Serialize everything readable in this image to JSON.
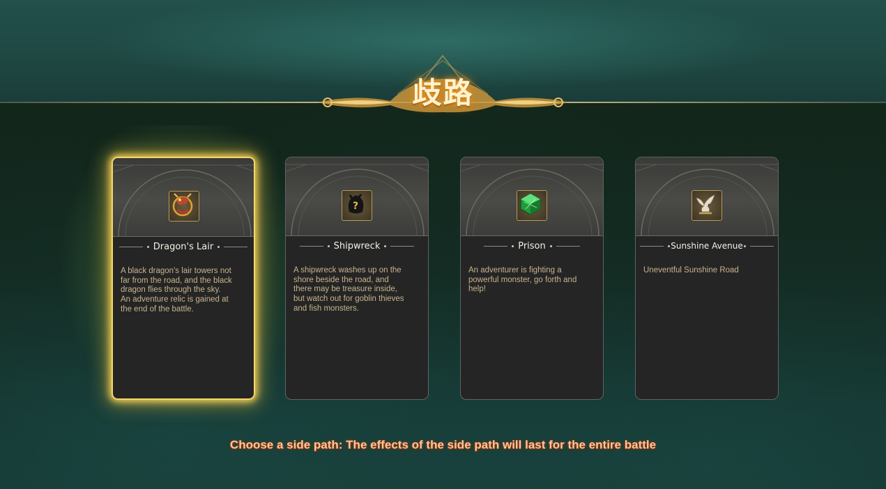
{
  "screen": {
    "title": "歧路",
    "hint": "Choose a side path: The effects of the side path will last for the entire battle",
    "accent_color": "#f4d66a",
    "hint_color": "#ffc59a"
  },
  "cards": [
    {
      "name": "Dragon's Lair",
      "icon": "dragon-icon",
      "selected": true,
      "description": "A black dragon's lair towers not far from the road, and the black dragon flies through the sky. An adventure relic is gained at the end of the battle."
    },
    {
      "name": "Shipwreck",
      "icon": "mystery-bag-icon",
      "selected": false,
      "description": "A shipwreck washes up on the shore beside the road, and there may be treasure inside, but watch out for goblin thieves and fish monsters."
    },
    {
      "name": "Prison",
      "icon": "green-gem-icon",
      "selected": false,
      "description": "An adventurer is fighting a powerful monster, go forth and help!"
    },
    {
      "name": "Sunshine Avenue",
      "icon": "dove-icon",
      "selected": false,
      "description": "Uneventful Sunshine Road"
    }
  ]
}
